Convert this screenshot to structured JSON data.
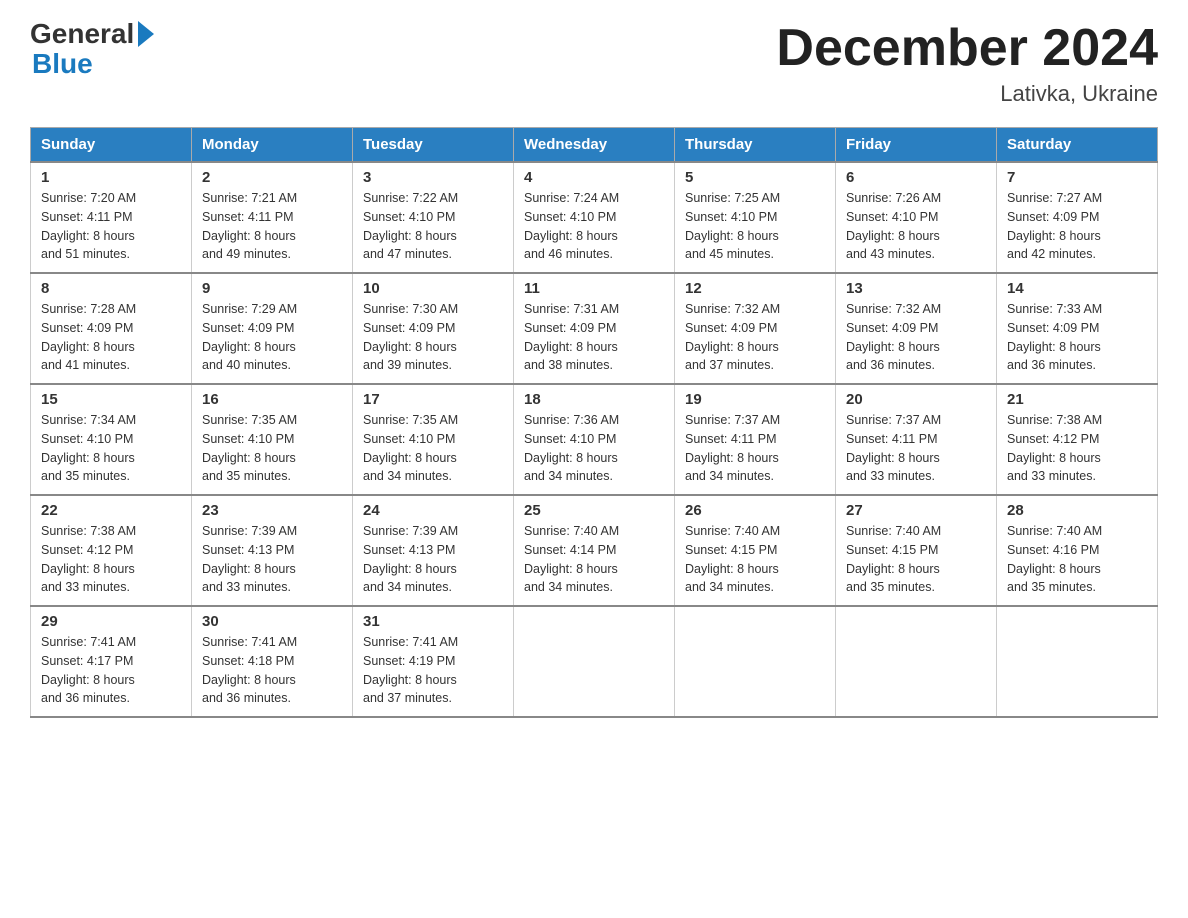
{
  "logo": {
    "general": "General",
    "blue": "Blue"
  },
  "title": "December 2024",
  "location": "Lativka, Ukraine",
  "weekdays": [
    "Sunday",
    "Monday",
    "Tuesday",
    "Wednesday",
    "Thursday",
    "Friday",
    "Saturday"
  ],
  "weeks": [
    [
      {
        "day": "1",
        "sunrise": "7:20 AM",
        "sunset": "4:11 PM",
        "daylight": "8 hours and 51 minutes."
      },
      {
        "day": "2",
        "sunrise": "7:21 AM",
        "sunset": "4:11 PM",
        "daylight": "8 hours and 49 minutes."
      },
      {
        "day": "3",
        "sunrise": "7:22 AM",
        "sunset": "4:10 PM",
        "daylight": "8 hours and 47 minutes."
      },
      {
        "day": "4",
        "sunrise": "7:24 AM",
        "sunset": "4:10 PM",
        "daylight": "8 hours and 46 minutes."
      },
      {
        "day": "5",
        "sunrise": "7:25 AM",
        "sunset": "4:10 PM",
        "daylight": "8 hours and 45 minutes."
      },
      {
        "day": "6",
        "sunrise": "7:26 AM",
        "sunset": "4:10 PM",
        "daylight": "8 hours and 43 minutes."
      },
      {
        "day": "7",
        "sunrise": "7:27 AM",
        "sunset": "4:09 PM",
        "daylight": "8 hours and 42 minutes."
      }
    ],
    [
      {
        "day": "8",
        "sunrise": "7:28 AM",
        "sunset": "4:09 PM",
        "daylight": "8 hours and 41 minutes."
      },
      {
        "day": "9",
        "sunrise": "7:29 AM",
        "sunset": "4:09 PM",
        "daylight": "8 hours and 40 minutes."
      },
      {
        "day": "10",
        "sunrise": "7:30 AM",
        "sunset": "4:09 PM",
        "daylight": "8 hours and 39 minutes."
      },
      {
        "day": "11",
        "sunrise": "7:31 AM",
        "sunset": "4:09 PM",
        "daylight": "8 hours and 38 minutes."
      },
      {
        "day": "12",
        "sunrise": "7:32 AM",
        "sunset": "4:09 PM",
        "daylight": "8 hours and 37 minutes."
      },
      {
        "day": "13",
        "sunrise": "7:32 AM",
        "sunset": "4:09 PM",
        "daylight": "8 hours and 36 minutes."
      },
      {
        "day": "14",
        "sunrise": "7:33 AM",
        "sunset": "4:09 PM",
        "daylight": "8 hours and 36 minutes."
      }
    ],
    [
      {
        "day": "15",
        "sunrise": "7:34 AM",
        "sunset": "4:10 PM",
        "daylight": "8 hours and 35 minutes."
      },
      {
        "day": "16",
        "sunrise": "7:35 AM",
        "sunset": "4:10 PM",
        "daylight": "8 hours and 35 minutes."
      },
      {
        "day": "17",
        "sunrise": "7:35 AM",
        "sunset": "4:10 PM",
        "daylight": "8 hours and 34 minutes."
      },
      {
        "day": "18",
        "sunrise": "7:36 AM",
        "sunset": "4:10 PM",
        "daylight": "8 hours and 34 minutes."
      },
      {
        "day": "19",
        "sunrise": "7:37 AM",
        "sunset": "4:11 PM",
        "daylight": "8 hours and 34 minutes."
      },
      {
        "day": "20",
        "sunrise": "7:37 AM",
        "sunset": "4:11 PM",
        "daylight": "8 hours and 33 minutes."
      },
      {
        "day": "21",
        "sunrise": "7:38 AM",
        "sunset": "4:12 PM",
        "daylight": "8 hours and 33 minutes."
      }
    ],
    [
      {
        "day": "22",
        "sunrise": "7:38 AM",
        "sunset": "4:12 PM",
        "daylight": "8 hours and 33 minutes."
      },
      {
        "day": "23",
        "sunrise": "7:39 AM",
        "sunset": "4:13 PM",
        "daylight": "8 hours and 33 minutes."
      },
      {
        "day": "24",
        "sunrise": "7:39 AM",
        "sunset": "4:13 PM",
        "daylight": "8 hours and 34 minutes."
      },
      {
        "day": "25",
        "sunrise": "7:40 AM",
        "sunset": "4:14 PM",
        "daylight": "8 hours and 34 minutes."
      },
      {
        "day": "26",
        "sunrise": "7:40 AM",
        "sunset": "4:15 PM",
        "daylight": "8 hours and 34 minutes."
      },
      {
        "day": "27",
        "sunrise": "7:40 AM",
        "sunset": "4:15 PM",
        "daylight": "8 hours and 35 minutes."
      },
      {
        "day": "28",
        "sunrise": "7:40 AM",
        "sunset": "4:16 PM",
        "daylight": "8 hours and 35 minutes."
      }
    ],
    [
      {
        "day": "29",
        "sunrise": "7:41 AM",
        "sunset": "4:17 PM",
        "daylight": "8 hours and 36 minutes."
      },
      {
        "day": "30",
        "sunrise": "7:41 AM",
        "sunset": "4:18 PM",
        "daylight": "8 hours and 36 minutes."
      },
      {
        "day": "31",
        "sunrise": "7:41 AM",
        "sunset": "4:19 PM",
        "daylight": "8 hours and 37 minutes."
      },
      null,
      null,
      null,
      null
    ]
  ],
  "labels": {
    "sunrise": "Sunrise: ",
    "sunset": "Sunset: ",
    "daylight": "Daylight: "
  }
}
